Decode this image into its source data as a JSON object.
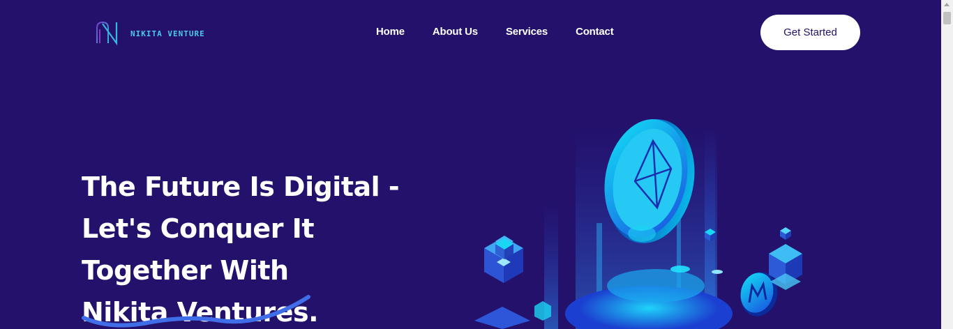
{
  "brand": {
    "name": "NIKITA VENTURE"
  },
  "nav": {
    "items": [
      {
        "label": "Home"
      },
      {
        "label": "About Us"
      },
      {
        "label": "Services"
      },
      {
        "label": "Contact"
      }
    ],
    "cta_label": "Get Started"
  },
  "hero": {
    "title_lines": [
      "The Future Is Digital -",
      "Let's Conquer It",
      "Together With",
      "Nikita Ventures."
    ]
  },
  "colors": {
    "background": "#23116b",
    "accent": "#4cc9e8",
    "button_bg": "#ffffff",
    "text": "#ffffff"
  }
}
